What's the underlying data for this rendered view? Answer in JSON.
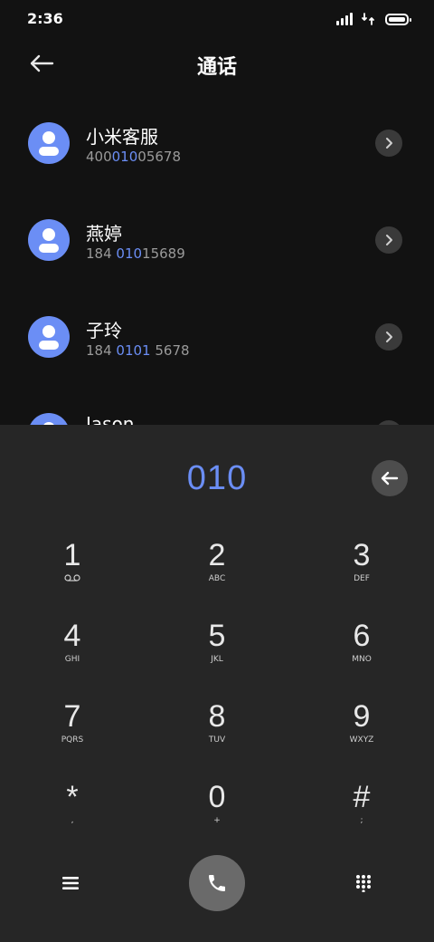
{
  "status_bar": {
    "time": "2:36",
    "icons": [
      "signal-icon",
      "data-transfer-icon",
      "battery-icon"
    ],
    "battery_level": 0.9
  },
  "header": {
    "title": "通话",
    "back_icon": "arrow-left-icon"
  },
  "contacts": [
    {
      "name": "小米客服",
      "number_pre": "400",
      "number_match": "010",
      "number_post": "05678"
    },
    {
      "name": "燕婷",
      "number_pre": "184 ",
      "number_match": "010",
      "number_post": "15689"
    },
    {
      "name": "子玲",
      "number_pre": "184 ",
      "number_match": "0101",
      "number_post": " 5678"
    },
    {
      "name": "Jason",
      "number_pre": "",
      "number_match": "",
      "number_post": ""
    }
  ],
  "dialer": {
    "input": "010",
    "delete_icon": "backspace-icon",
    "keys": [
      {
        "digit": "1",
        "letters": ""
      },
      {
        "digit": "2",
        "letters": "ABC"
      },
      {
        "digit": "3",
        "letters": "DEF"
      },
      {
        "digit": "4",
        "letters": "GHI"
      },
      {
        "digit": "5",
        "letters": "JKL"
      },
      {
        "digit": "6",
        "letters": "MNO"
      },
      {
        "digit": "7",
        "letters": "PQRS"
      },
      {
        "digit": "8",
        "letters": "TUV"
      },
      {
        "digit": "9",
        "letters": "WXYZ"
      },
      {
        "digit": "*",
        "letters": ","
      },
      {
        "digit": "0",
        "letters": "+"
      },
      {
        "digit": "#",
        "letters": ";"
      }
    ],
    "bottom_icons": [
      "menu-icon",
      "phone-icon",
      "dialpad-icon"
    ]
  },
  "colors": {
    "accent": "#6b8ef5",
    "background": "#121212",
    "panel": "#262626",
    "call_button": "#6a6a6a"
  }
}
